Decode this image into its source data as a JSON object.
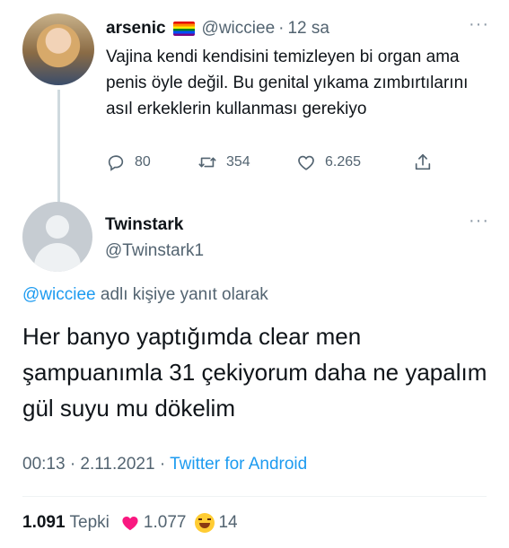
{
  "parent": {
    "name": "arsenic",
    "handle": "@wicciee",
    "separator": "·",
    "time": "12 sa",
    "text": "Vajina kendi kendisini temizleyen bi organ ama penis öyle değil. Bu genital yıkama zımbırtılarını asıl erkeklerin kullanması gerekiyo",
    "replies": "80",
    "retweets": "354",
    "likes": "6.265"
  },
  "reply": {
    "name": "Twinstark",
    "handle": "@Twinstark1",
    "reply_to_mention": "@wicciee",
    "reply_to_suffix": " adlı kişiye yanıt olarak",
    "text": "Her banyo yaptığımda clear men şampuanımla 31 çekiyorum daha ne yapalım gül suyu mu dökelim",
    "time": "00:13 · 2.11.2021 · ",
    "source": "Twitter for Android",
    "reaction_total": "1.091",
    "reaction_label": "Tepki",
    "heart_count": "1.077",
    "laugh_count": "14"
  },
  "colors": {
    "accent": "#1d9bf0",
    "muted": "#536471",
    "text": "#0f1419",
    "heart": "#f91880"
  },
  "icons": [
    "more-icon",
    "reply-icon",
    "retweet-icon",
    "like-icon",
    "share-icon",
    "heart-reaction-icon",
    "laugh-reaction-icon",
    "pride-flag-icon"
  ]
}
